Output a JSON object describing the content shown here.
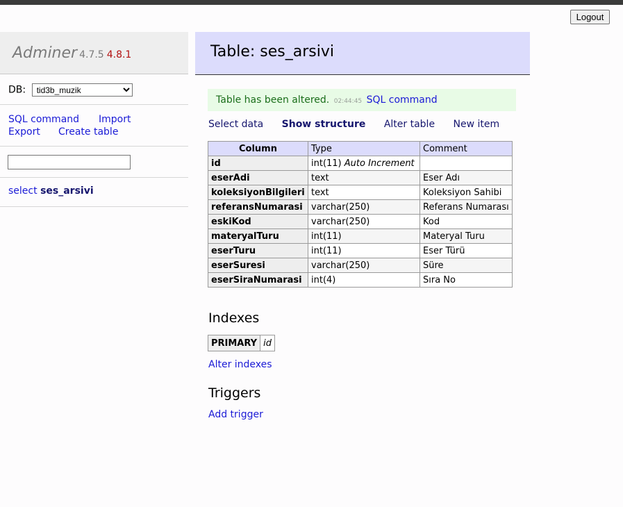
{
  "topbar": {
    "logout_label": "Logout"
  },
  "sidebar": {
    "app_name": "Adminer",
    "version": "4.7.5",
    "new_version": "4.8.1",
    "db_label": "DB:",
    "db_selected": "tid3b_muzik",
    "links": [
      "SQL command",
      "Import",
      "Export",
      "Create table"
    ],
    "search_value": "",
    "table_action": "select",
    "table_name": "ses_arsivi"
  },
  "header": {
    "title": "Table: ses_arsivi"
  },
  "message": {
    "text": "Table has been altered.",
    "time": "02:44:45",
    "link": "SQL command"
  },
  "nav": [
    "Select data",
    "Show structure",
    "Alter table",
    "New item"
  ],
  "structure": {
    "headers": [
      "Column",
      "Type",
      "Comment"
    ],
    "rows": [
      {
        "column": "id",
        "type": "int(11)",
        "extra": "Auto Increment",
        "comment": ""
      },
      {
        "column": "eserAdi",
        "type": "text",
        "extra": "",
        "comment": "Eser Adı"
      },
      {
        "column": "koleksiyonBilgileri",
        "type": "text",
        "extra": "",
        "comment": "Koleksiyon Sahibi"
      },
      {
        "column": "referansNumarasi",
        "type": "varchar(250)",
        "extra": "",
        "comment": "Referans Numarası"
      },
      {
        "column": "eskiKod",
        "type": "varchar(250)",
        "extra": "",
        "comment": "Kod"
      },
      {
        "column": "materyalTuru",
        "type": "int(11)",
        "extra": "",
        "comment": "Materyal Turu"
      },
      {
        "column": "eserTuru",
        "type": "int(11)",
        "extra": "",
        "comment": "Eser Türü"
      },
      {
        "column": "eserSuresi",
        "type": "varchar(250)",
        "extra": "",
        "comment": "Süre"
      },
      {
        "column": "eserSiraNumarasi",
        "type": "int(4)",
        "extra": "",
        "comment": "Sıra No"
      }
    ]
  },
  "indexes": {
    "heading": "Indexes",
    "type": "PRIMARY",
    "column": "id",
    "alter_link": "Alter indexes"
  },
  "triggers": {
    "heading": "Triggers",
    "add_link": "Add trigger"
  }
}
